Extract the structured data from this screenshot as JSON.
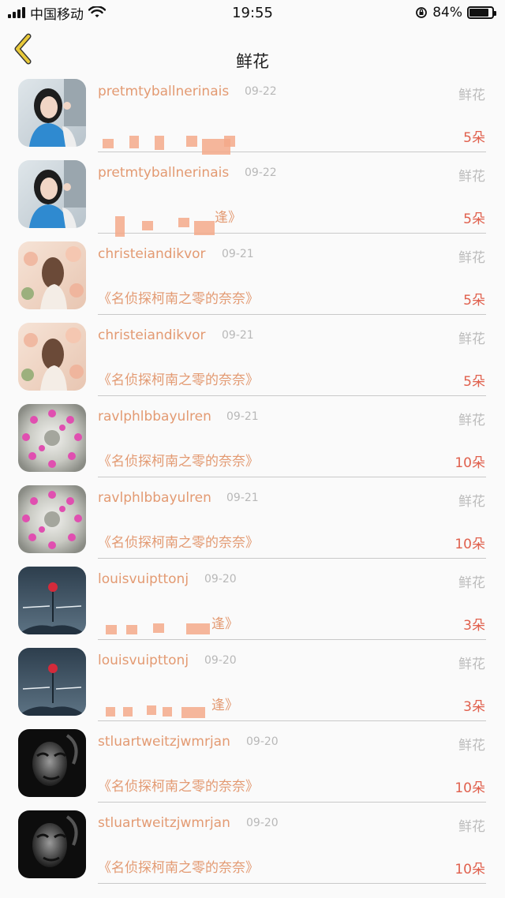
{
  "status_bar": {
    "carrier": "中国移动",
    "time": "19:55",
    "battery_percent": "84%",
    "battery_level": 0.84
  },
  "nav": {
    "title": "鲜花"
  },
  "rows": [
    {
      "username": "pretmtyballnerinais",
      "date": "09-22",
      "gift": "鲜花",
      "message": "",
      "count": "5朵",
      "avatar": "girl-photo"
    },
    {
      "username": "pretmtyballnerinais",
      "date": "09-22",
      "gift": "鲜花",
      "message": "逢》",
      "count": "5朵",
      "avatar": "girl-photo"
    },
    {
      "username": "christeiandikvor",
      "date": "09-21",
      "gift": "鲜花",
      "message": "《名侦探柯南之零的奈奈》",
      "count": "5朵",
      "avatar": "floral-girl"
    },
    {
      "username": "christeiandikvor",
      "date": "09-21",
      "gift": "鲜花",
      "message": "《名侦探柯南之零的奈奈》",
      "count": "5朵",
      "avatar": "floral-girl"
    },
    {
      "username": "ravlphlbbayulren",
      "date": "09-21",
      "gift": "鲜花",
      "message": "《名侦探柯南之零的奈奈》",
      "count": "10朵",
      "avatar": "cactus-flower"
    },
    {
      "username": "ravlphlbbayulren",
      "date": "09-21",
      "gift": "鲜花",
      "message": "《名侦探柯南之零的奈奈》",
      "count": "10朵",
      "avatar": "cactus-flower"
    },
    {
      "username": "louisvuipttonj",
      "date": "09-20",
      "gift": "鲜花",
      "message": "逢》",
      "count": "3朵",
      "avatar": "rose-dark"
    },
    {
      "username": "louisvuipttonj",
      "date": "09-20",
      "gift": "鲜花",
      "message": "逢》",
      "count": "3朵",
      "avatar": "rose-dark"
    },
    {
      "username": "stluartweitzjwmrjan",
      "date": "09-20",
      "gift": "鲜花",
      "message": "《名侦探柯南之零的奈奈》",
      "count": "10朵",
      "avatar": "bw-face"
    },
    {
      "username": "stluartweitzjwmrjan",
      "date": "09-20",
      "gift": "鲜花",
      "message": "《名侦探柯南之零的奈奈》",
      "count": "10朵",
      "avatar": "bw-face"
    }
  ]
}
